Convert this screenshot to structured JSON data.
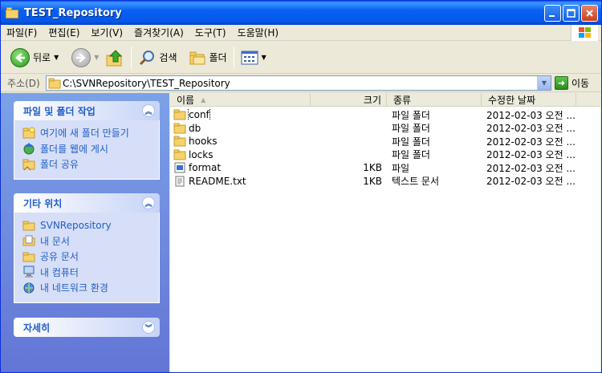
{
  "window": {
    "title": "TEST_Repository"
  },
  "menu": [
    "파일(F)",
    "편집(E)",
    "보기(V)",
    "즐겨찾기(A)",
    "도구(T)",
    "도움말(H)"
  ],
  "toolbar": {
    "back_label": "뒤로",
    "search_label": "검색",
    "folders_label": "폴더"
  },
  "address": {
    "label": "주소(D)",
    "value": "C:\\SVNRepository\\TEST_Repository",
    "go_label": "이동"
  },
  "tasks_panel": {
    "title": "파일 및 폴더 작업",
    "items": [
      "여기에 새 폴더 만들기",
      "폴더를 웹에 게시",
      "폴더 공유"
    ]
  },
  "places_panel": {
    "title": "기타 위치",
    "items": [
      "SVNRepository",
      "내 문서",
      "공유 문서",
      "내 컴퓨터",
      "내 네트워크 환경"
    ]
  },
  "details_panel": {
    "title": "자세히"
  },
  "columns": {
    "name": "이름",
    "size": "크기",
    "type": "종류",
    "modified": "수정한 날짜"
  },
  "files": [
    {
      "name": "conf",
      "size": "",
      "type": "파일 폴더",
      "modified": "2012-02-03 오전 ...",
      "icon": "folder-icon"
    },
    {
      "name": "db",
      "size": "",
      "type": "파일 폴더",
      "modified": "2012-02-03 오전 ...",
      "icon": "folder-icon"
    },
    {
      "name": "hooks",
      "size": "",
      "type": "파일 폴더",
      "modified": "2012-02-03 오전 ...",
      "icon": "folder-icon"
    },
    {
      "name": "locks",
      "size": "",
      "type": "파일 폴더",
      "modified": "2012-02-03 오전 ...",
      "icon": "folder-icon"
    },
    {
      "name": "format",
      "size": "1KB",
      "type": "파일",
      "modified": "2012-02-03 오전 ...",
      "icon": "file-icon"
    },
    {
      "name": "README.txt",
      "size": "1KB",
      "type": "텍스트 문서",
      "modified": "2012-02-03 오전 ...",
      "icon": "text-file-icon"
    }
  ]
}
